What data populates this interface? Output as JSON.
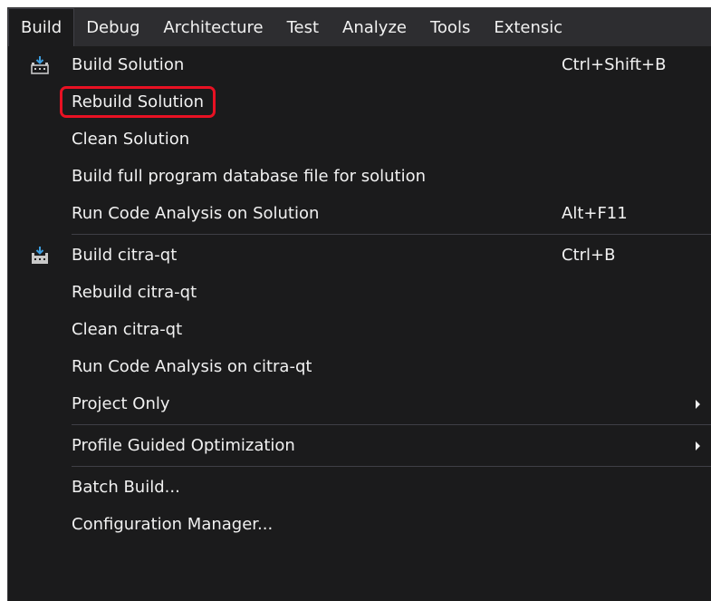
{
  "menubar": {
    "items": [
      "Build",
      "Debug",
      "Architecture",
      "Test",
      "Analyze",
      "Tools",
      "Extensic"
    ]
  },
  "menu": {
    "build_solution": {
      "label": "Build Solution",
      "shortcut": "Ctrl+Shift+B",
      "icon": "build-icon"
    },
    "rebuild_solution": {
      "label": "Rebuild Solution"
    },
    "clean_solution": {
      "label": "Clean Solution"
    },
    "build_pdb": {
      "label": "Build full program database file for solution"
    },
    "run_code_analysis_solution": {
      "label": "Run Code Analysis on Solution",
      "shortcut": "Alt+F11"
    },
    "build_project": {
      "label": "Build citra-qt",
      "shortcut": "Ctrl+B",
      "icon": "build-icon"
    },
    "rebuild_project": {
      "label": "Rebuild citra-qt"
    },
    "clean_project": {
      "label": "Clean citra-qt"
    },
    "run_code_analysis_project": {
      "label": "Run Code Analysis on citra-qt"
    },
    "project_only": {
      "label": "Project Only"
    },
    "profile_guided": {
      "label": "Profile Guided Optimization"
    },
    "batch_build": {
      "label": "Batch Build..."
    },
    "configuration_manager": {
      "label": "Configuration Manager..."
    }
  },
  "colors": {
    "highlight": "#e81123",
    "menu_bg": "#1b1b1c",
    "menubar_bg": "#2d2d30",
    "text": "#f1f1f1"
  }
}
